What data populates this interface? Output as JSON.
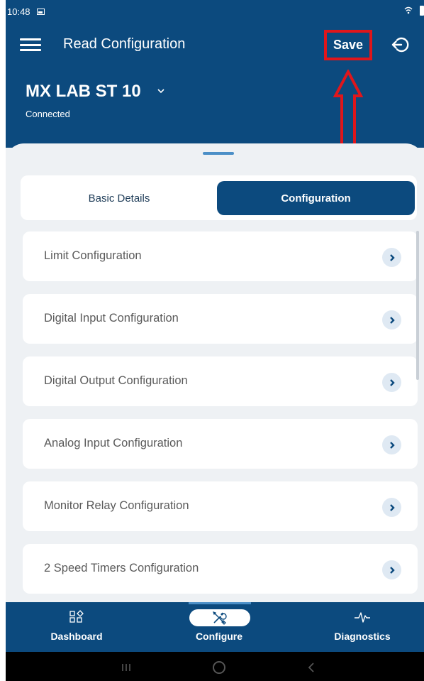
{
  "status_bar": {
    "time": "10:48"
  },
  "header": {
    "title": "Read Configuration",
    "save_label": "Save",
    "device_name": "MX LAB ST 10",
    "connection_status": "Connected"
  },
  "tabs": [
    {
      "label": "Basic Details",
      "active": false
    },
    {
      "label": "Configuration",
      "active": true
    }
  ],
  "config_items": [
    {
      "label": "Limit Configuration"
    },
    {
      "label": "Digital Input Configuration"
    },
    {
      "label": "Digital Output Configuration"
    },
    {
      "label": "Analog Input Configuration"
    },
    {
      "label": "Monitor Relay Configuration"
    },
    {
      "label": "2 Speed Timers Configuration"
    }
  ],
  "bottom_nav": [
    {
      "label": "Dashboard",
      "icon": "dashboard-icon"
    },
    {
      "label": "Configure",
      "icon": "wrench-screwdriver-icon",
      "active": true
    },
    {
      "label": "Diagnostics",
      "icon": "pulse-icon"
    }
  ],
  "colors": {
    "primary": "#0c4a7e",
    "annotation": "#e0161b",
    "accent": "#4b8fc7"
  }
}
